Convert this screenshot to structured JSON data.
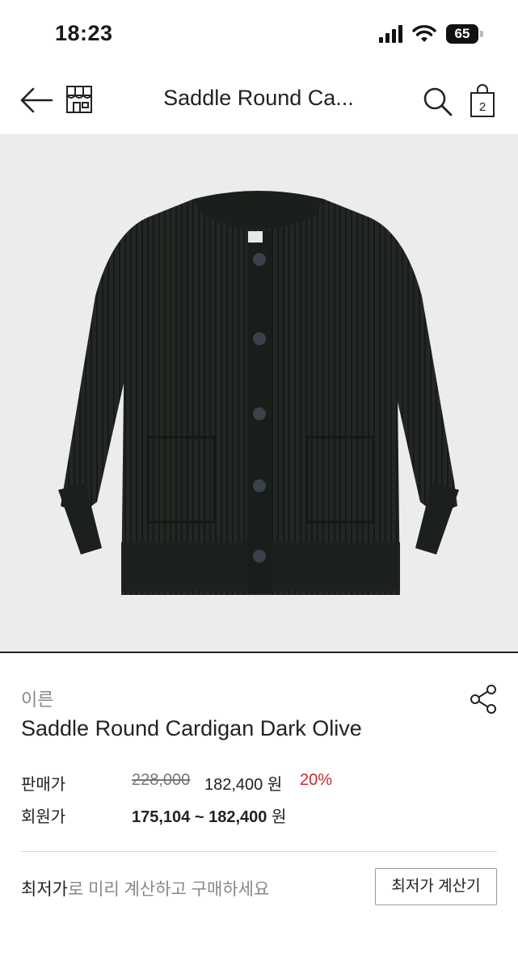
{
  "status_bar": {
    "time": "18:23",
    "battery": "65"
  },
  "header": {
    "title": "Saddle Round Ca...",
    "cart_count": "2"
  },
  "product": {
    "brand": "이른",
    "name": "Saddle Round Cardigan Dark Olive",
    "image_icon": "cardigan-photo"
  },
  "pricing": {
    "sale_label": "판매가",
    "original_price": "228,000",
    "sale_price": "182,400 원",
    "discount": "20%",
    "member_label": "회원가",
    "member_range": "175,104 ~ 182,400",
    "member_unit": "원"
  },
  "lowest_price": {
    "text_strong": "최저가",
    "text_rest": "로 미리 계산하고 구매하세요",
    "button_label": "최저가 계산기"
  },
  "colors": {
    "accent_red": "#c8272d",
    "image_bg": "#ececec",
    "garment": "#232723"
  }
}
